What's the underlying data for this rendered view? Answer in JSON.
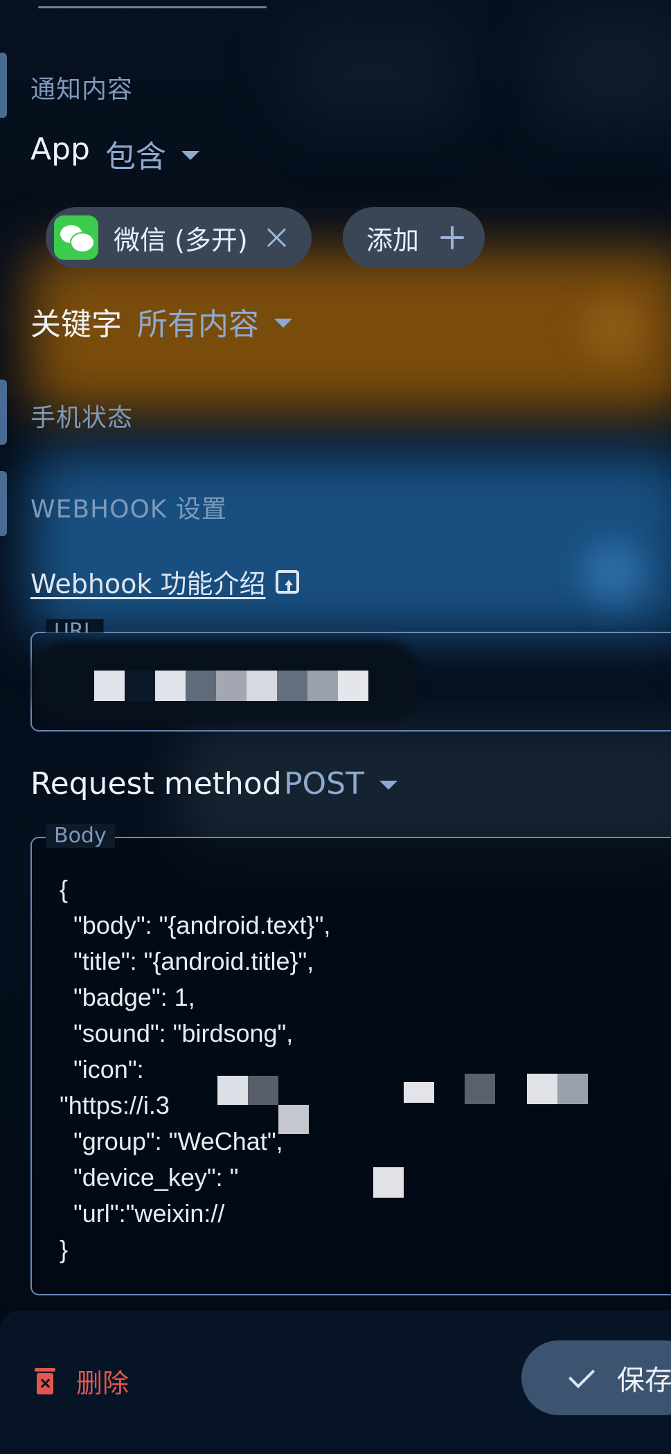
{
  "notification_content": {
    "title": "通知内容",
    "app_label": "App",
    "app_match_mode": "包含",
    "apps": [
      {
        "label": "微信 (多开)",
        "icon": "wechat-icon"
      }
    ],
    "add_label": "添加",
    "keyword_label": "关键字",
    "keyword_mode": "所有内容"
  },
  "phone_state": {
    "title": "手机状态"
  },
  "webhook": {
    "title": "WEBHOOK 设置",
    "intro_link": "Webhook 功能介绍",
    "url_label": "URL",
    "method_label": "Request method",
    "method_value": "POST",
    "body_label": "Body",
    "body_lines": [
      "{",
      "  \"body\": \"{android.text}\",",
      "  \"title\": \"{android.title}\",",
      "  \"badge\": 1,",
      "  \"sound\": \"birdsong\",",
      "  \"icon\":",
      "\"https://i.3",
      "  \"group\": \"WeChat\",",
      "  \"device_key\": \"",
      "  \"url\":\"weixin://",
      "}"
    ]
  },
  "actions": {
    "delete_label": "删除",
    "save_label": "保存"
  },
  "colors": {
    "accent": "#8eaad0",
    "section_title": "#7e99bb",
    "delete": "#e2574c",
    "wechat_green": "#3ccb4d"
  }
}
